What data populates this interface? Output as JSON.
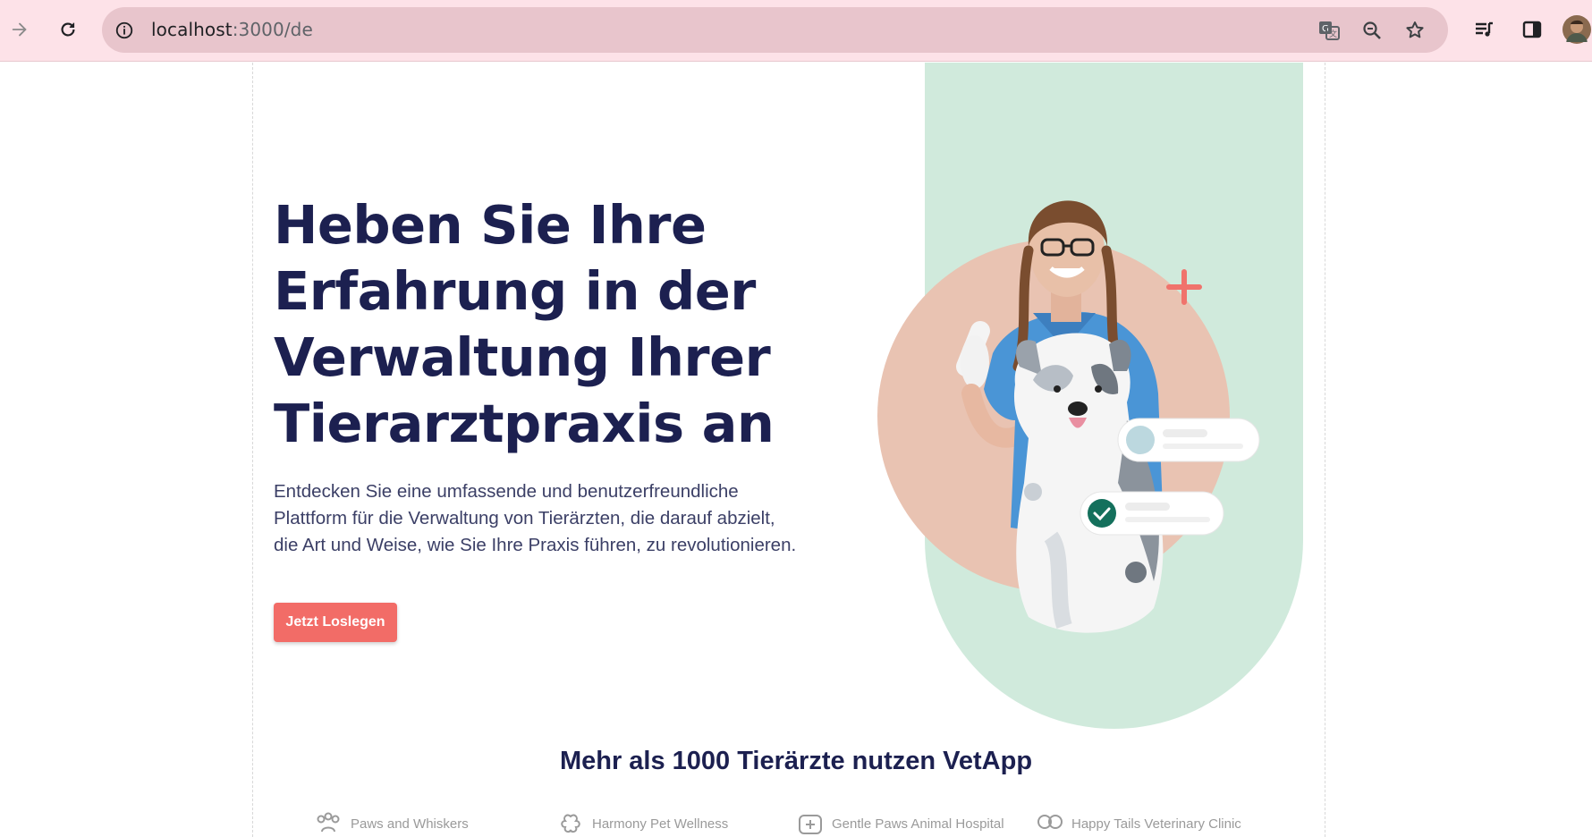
{
  "browser": {
    "url_host": "localhost",
    "url_path": ":3000/de",
    "icons": [
      "forward-icon",
      "reload-icon",
      "info-icon",
      "translate-icon",
      "zoom-icon",
      "bookmark-star-icon",
      "media-queue-icon",
      "side-panel-icon",
      "profile-avatar"
    ]
  },
  "hero": {
    "title_lines": [
      "Heben Sie Ihre",
      "Erfahrung in der",
      "Verwaltung Ihrer",
      "Tierarztpraxis an"
    ],
    "description": "Entdecken Sie eine umfassende und benutzerfreundliche Plattform für die Verwaltung von Tierärzten, die darauf abzielt, die Art und Weise, wie Sie Ihre Praxis führen, zu revolutionieren.",
    "cta_label": "Jetzt Loslegen"
  },
  "social_proof": {
    "title": "Mehr als 1000 Tierärzte nutzen VetApp",
    "logos": [
      {
        "name": "Paws and Whiskers",
        "icon": "paw-icon"
      },
      {
        "name": "Harmony Pet Wellness",
        "icon": "flower-icon"
      },
      {
        "name": "Gentle Paws Animal Hospital",
        "icon": "medical-cross-icon"
      },
      {
        "name": "Happy Tails Veterinary Clinic",
        "icon": "circles-icon"
      }
    ]
  },
  "colors": {
    "chrome_bg": "#fde2e8",
    "omnibox_bg": "#e8c5cc",
    "title": "#1c2050",
    "accent": "#f26c67",
    "hero_shape": "#d0eadc",
    "circle": "#e9c3b2"
  }
}
